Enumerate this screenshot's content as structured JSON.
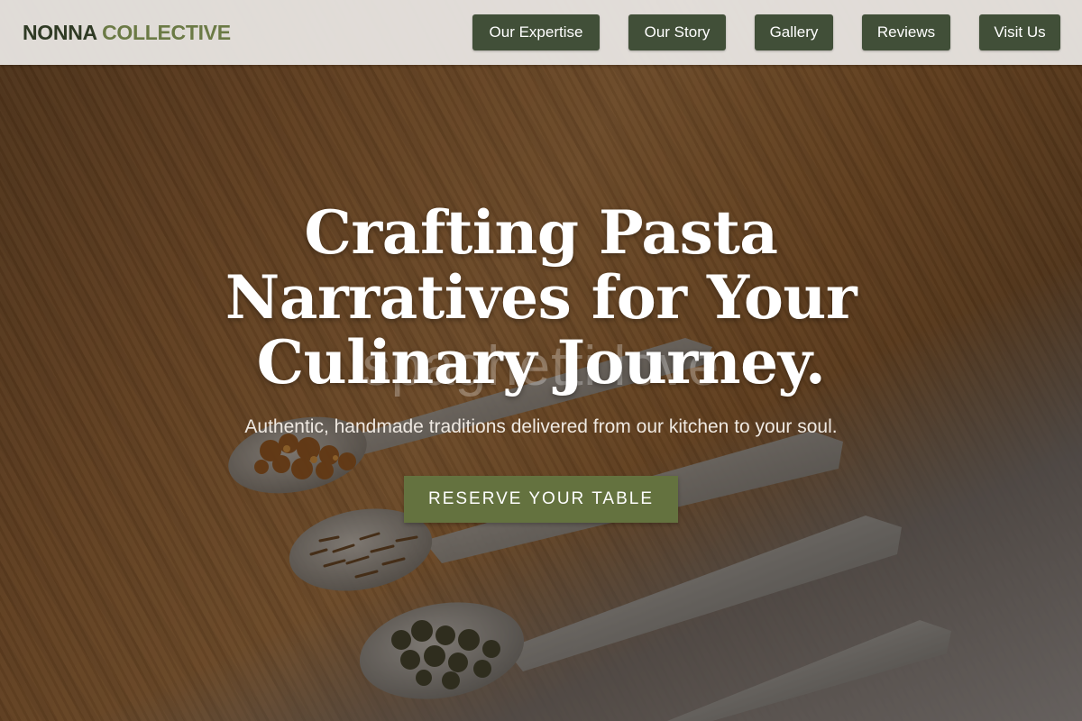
{
  "brand": {
    "name_part1": "NONNA",
    "name_part2": "COLLECTIVE",
    "color_part1": "#2f3a24",
    "color_part2": "#6b7a45"
  },
  "nav": {
    "items": [
      {
        "label": "Our Expertise"
      },
      {
        "label": "Our Story"
      },
      {
        "label": "Gallery"
      },
      {
        "label": "Reviews"
      },
      {
        "label": "Visit Us"
      }
    ],
    "button_color": "#414f38"
  },
  "hero": {
    "watermark": "spaghetti love",
    "headline": "Crafting Pasta Narratives for Your Culinary Journey.",
    "subtext": "Authentic, handmade traditions delivered from our kitchen to your soul.",
    "cta_label": "RESERVE YOUR TABLE",
    "cta_color": "#64723f",
    "background": "wooden-table-with-spice-spoons-photo"
  }
}
